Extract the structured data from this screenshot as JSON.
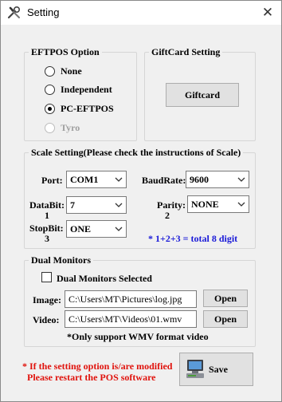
{
  "window": {
    "title": "Setting",
    "close_glyph": "✕"
  },
  "eftpos": {
    "legend": "EFTPOS Option",
    "options": [
      {
        "label": "None",
        "selected": false,
        "enabled": true
      },
      {
        "label": "Independent",
        "selected": false,
        "enabled": true
      },
      {
        "label": "PC-EFTPOS",
        "selected": true,
        "enabled": true
      },
      {
        "label": "Tyro",
        "selected": false,
        "enabled": false
      }
    ]
  },
  "giftcard": {
    "legend": "GiftCard Setting",
    "button_label": "Giftcard"
  },
  "scale": {
    "legend": "Scale Setting(Please check the instructions of Scale)",
    "port_label": "Port:",
    "port_value": "COM1",
    "baudrate_label": "BaudRate:",
    "baudrate_value": "9600",
    "databit_label": "DataBit:",
    "databit_num": "1",
    "databit_value": "7",
    "parity_label": "Parity:",
    "parity_num": "2",
    "parity_value": "NONE",
    "stopbit_label": "StopBit:",
    "stopbit_num": "3",
    "stopbit_value": "ONE",
    "digit_note": "* 1+2+3 = total 8 digit"
  },
  "dual": {
    "legend": "Dual Monitors",
    "checkbox_label": "Dual Monitors Selected",
    "checkbox_checked": false,
    "image_label": "Image:",
    "image_value": "C:\\Users\\MT\\Pictures\\log.jpg",
    "video_label": "Video:",
    "video_value": "C:\\Users\\MT\\Videos\\01.wmv",
    "open_label": "Open",
    "video_note": "*Only support WMV format video"
  },
  "footer": {
    "warning_line1": "* If the setting option is/are modified",
    "warning_line2": "Please restart the POS software",
    "save_label": "Save"
  },
  "colors": {
    "accent_blue": "#1a1ad8",
    "warning_red": "#e0120c"
  },
  "icons": [
    "tools-icon",
    "close-icon",
    "chevron-down-icon",
    "computer-save-icon"
  ]
}
